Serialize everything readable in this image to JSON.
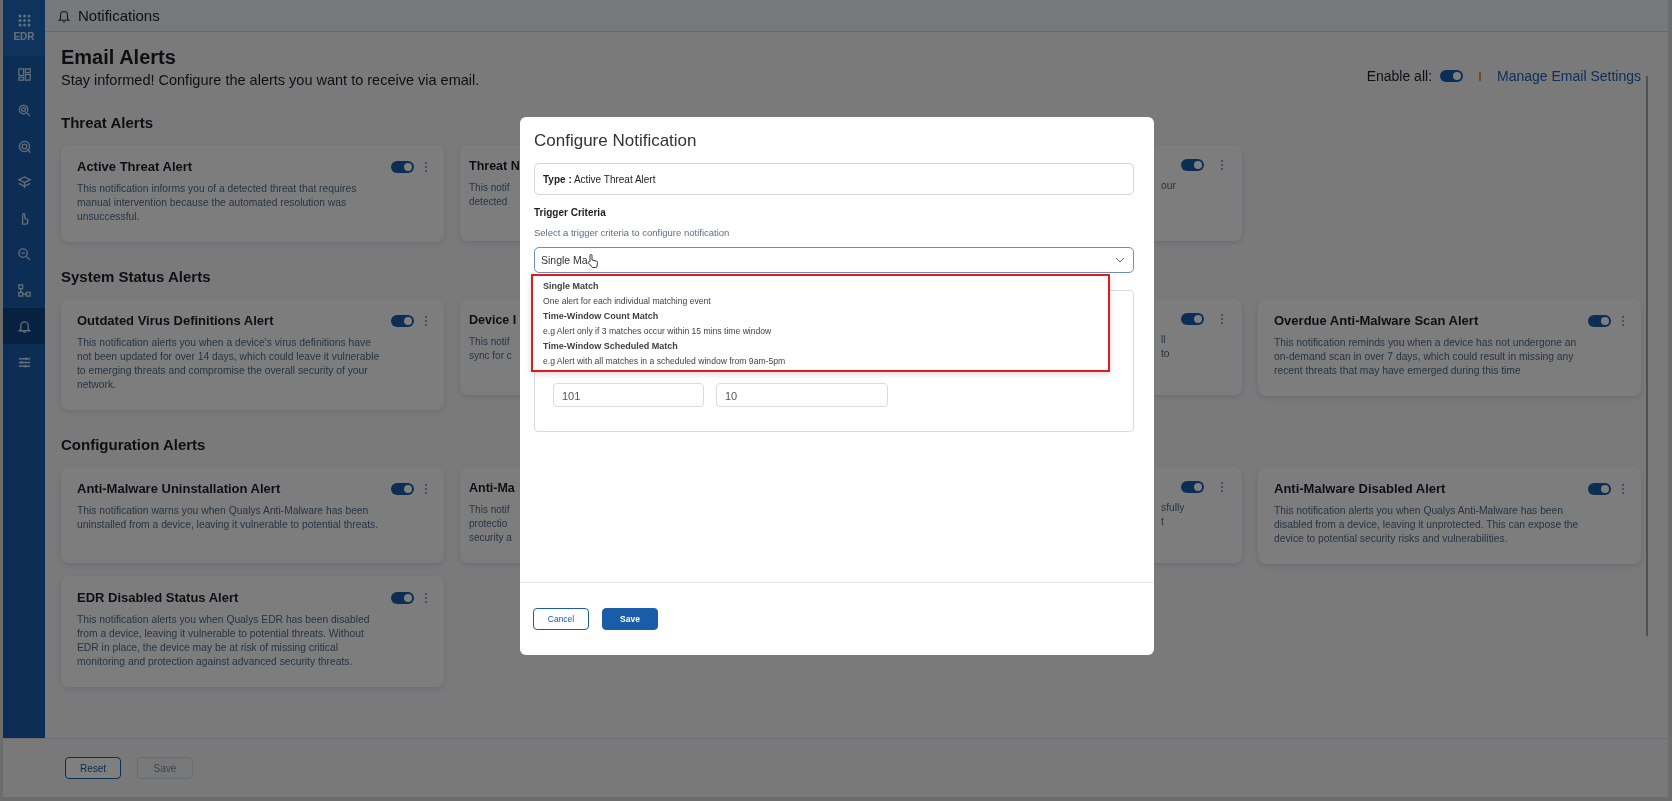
{
  "app": {
    "label": "EDR"
  },
  "sidebar": {
    "items": [
      {
        "kind": "dashboard",
        "selected": false
      },
      {
        "kind": "search",
        "selected": false
      },
      {
        "kind": "target",
        "selected": false
      },
      {
        "kind": "layers",
        "selected": false
      },
      {
        "kind": "hand",
        "selected": false
      },
      {
        "kind": "zoom",
        "selected": false
      },
      {
        "kind": "hierarchy",
        "selected": false
      },
      {
        "kind": "bell",
        "selected": true
      },
      {
        "kind": "sliders",
        "selected": false
      }
    ]
  },
  "header": {
    "title": "Notifications"
  },
  "page": {
    "title": "Email Alerts",
    "subtitle": "Stay informed! Configure the alerts you want to receive via email.",
    "enable_all": {
      "label": "Enable all:",
      "on": true
    },
    "manage_link": "Manage Email Settings"
  },
  "sections": [
    {
      "title": "Threat Alerts",
      "cards": [
        {
          "kind": "full",
          "title": "Active Threat Alert",
          "description": "This notification informs you of a detected threat that requires manual intervention because the automated resolution was unsuccessful.",
          "enabled": true
        },
        {
          "kind": "left",
          "title": "Threat N",
          "lines": [
            "This notif",
            "detected"
          ]
        },
        {
          "kind": "right",
          "lines": [
            "our"
          ],
          "enabled": true
        }
      ]
    },
    {
      "title": "System Status Alerts",
      "cards": [
        {
          "kind": "full",
          "title": "Outdated Virus Definitions Alert",
          "description": "This notification alerts you when a device's virus definitions have not been updated for over 14 days, which could leave it vulnerable to emerging threats and compromise the overall security of your network.",
          "enabled": true
        },
        {
          "kind": "left",
          "title": "Device I",
          "lines": [
            "This notif",
            "sync for c"
          ]
        },
        {
          "kind": "right",
          "lines": [
            "ll",
            "to"
          ],
          "enabled": true
        },
        {
          "kind": "full",
          "title": "Overdue Anti-Malware Scan Alert",
          "description": "This notification reminds you when a device has not undergone an on-demand scan in over 7 days, which could result in missing any recent threats that may have emerged during this time",
          "enabled": true
        }
      ]
    },
    {
      "title": "Configuration Alerts",
      "cards": [
        {
          "kind": "full",
          "title": "Anti-Malware Uninstallation Alert",
          "description": "This notification warns you when Qualys Anti-Malware has been uninstalled from a device, leaving it vulnerable to potential threats.",
          "enabled": true
        },
        {
          "kind": "left",
          "title": "Anti-Ma",
          "lines": [
            "This notif",
            "protectio",
            "security a"
          ]
        },
        {
          "kind": "right",
          "lines": [
            "sfully",
            "t"
          ],
          "enabled": true
        },
        {
          "kind": "full",
          "title": "Anti-Malware Disabled Alert",
          "description": "This notification alerts you when Qualys Anti-Malware has been disabled from a device, leaving it unprotected. This can expose the device to potential security risks and vulnerabilities.",
          "enabled": true
        },
        {
          "kind": "full",
          "title": "EDR Disabled Status Alert",
          "description": "This notification alerts you when Qualys EDR has been disabled from a device, leaving it vulnerable to potential threats. Without EDR in place, the device may be at risk of missing critical monitoring and protection against advanced security threats.",
          "enabled": true
        }
      ]
    }
  ],
  "footer": {
    "buttons": [
      {
        "label": "Reset",
        "disabled": false
      },
      {
        "label": "Save",
        "disabled": true
      }
    ]
  },
  "modal": {
    "title": "Configure Notification",
    "type_label": "Type :",
    "type_value": "Active Threat Alert",
    "trigger_title": "Trigger Criteria",
    "trigger_hint": "Select a trigger criteria to configure notification",
    "select_value": "Single Ma",
    "options": [
      {
        "title": "Single Match",
        "description": "One alert for each individual matching event"
      },
      {
        "title": "Time-Window Count Match",
        "description": "e.g Alert only if 3 matches occur within 15 mins time window"
      },
      {
        "title": "Time-Window Scheduled Match",
        "description": "e.g Alert with all matches in a scheduled window from 9am-5pm"
      }
    ],
    "inputs": [
      "101",
      "10"
    ],
    "buttons": [
      {
        "label": "Cancel",
        "kind": "secondary"
      },
      {
        "label": "Save",
        "kind": "primary"
      }
    ]
  }
}
